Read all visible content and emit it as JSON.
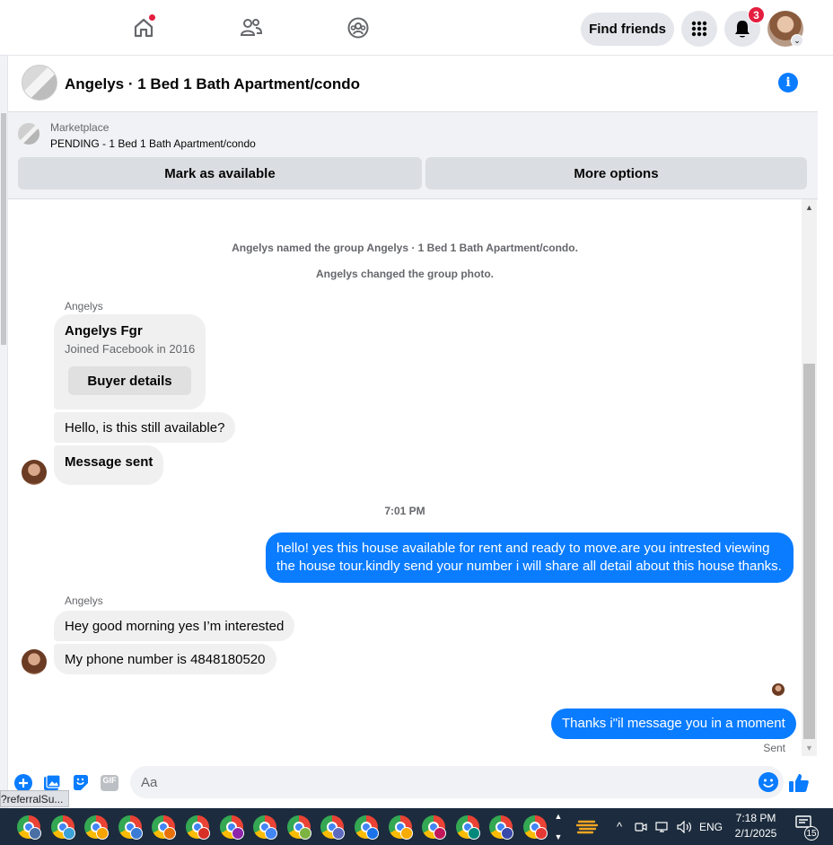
{
  "nav": {
    "find_friends": "Find friends",
    "notifications_count": "3",
    "icons": [
      "home-icon",
      "friends-icon",
      "groups-icon",
      "menu-grid-icon",
      "bell-icon"
    ]
  },
  "chat": {
    "title": "Angelys · 1 Bed 1 Bath Apartment/condo"
  },
  "marketplace": {
    "label": "Marketplace",
    "status": "PENDING - 1 Bed 1 Bath Apartment/condo",
    "mark_available": "Mark as available",
    "more_options": "More options"
  },
  "messages": {
    "system_1": "Angelys named the group Angelys · 1 Bed 1 Bath Apartment/condo.",
    "system_2": "Angelys changed the group photo.",
    "sender_1": "Angelys",
    "card": {
      "name": "Angelys Fgr",
      "joined": "Joined Facebook in 2016",
      "button": "Buyer details"
    },
    "in_1": "Hello, is this still available?",
    "in_2": "Message sent",
    "time": "7:01 PM",
    "out_1": "hello! yes this house available for rent and ready to move.are you intrested viewing the house tour.kindly send your number i will share all detail about this house thanks.",
    "sender_2": "Angelys",
    "in_3": "Hey good morning yes I’m interested",
    "in_4": "My phone number is 4848180520",
    "out_2": "Thanks i\"il message you in a moment",
    "sent_status": "Sent"
  },
  "composer": {
    "placeholder": "Aa",
    "icons": [
      "plus-icon",
      "image-icon",
      "sticker-icon",
      "gif-icon",
      "emoji-icon",
      "thumbs-up-icon"
    ],
    "gif_label": "GIF"
  },
  "status_url": "?referralSu...",
  "taskbar": {
    "language": "ENG",
    "time": "7:18 PM",
    "date": "2/1/2025",
    "notification_count": "15",
    "chrome_profile_colors": [
      "#4a6fa5",
      "#3aa0d8",
      "#f4a300",
      "#3a7bd5",
      "#e8710a",
      "#d93025",
      "#8e24aa",
      "#4285f4",
      "#7cb342",
      "#5c6bc0",
      "#1a73e8",
      "#f9ab00",
      "#c2185b",
      "#00897b",
      "#3949ab",
      "#e53935"
    ]
  }
}
